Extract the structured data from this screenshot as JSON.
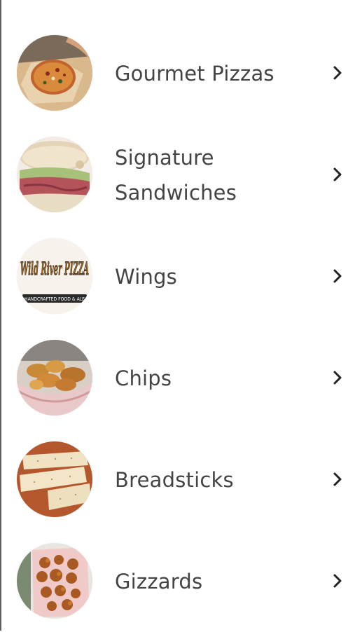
{
  "menu": {
    "items": [
      {
        "label": "Gourmet Pizzas",
        "thumbnail": "pizza-in-box-photo",
        "chevron": "chevron-right-icon"
      },
      {
        "label": "Signature Sandwiches",
        "thumbnail": "sandwich-photo",
        "chevron": "chevron-right-icon"
      },
      {
        "label": "Wings",
        "thumbnail": "wild-river-pizza-logo",
        "chevron": "chevron-right-icon"
      },
      {
        "label": "Chips",
        "thumbnail": "chips-basket-photo",
        "chevron": "chevron-right-icon"
      },
      {
        "label": "Breadsticks",
        "thumbnail": "breadsticks-photo",
        "chevron": "chevron-right-icon"
      },
      {
        "label": "Gizzards",
        "thumbnail": "gizzards-basket-photo",
        "chevron": "chevron-right-icon"
      }
    ],
    "logo_text": "Wild River PIZZA",
    "logo_tagline": "HANDCRAFTED FOOD & ALE"
  },
  "colors": {
    "background": "#ffffff",
    "text": "#444444",
    "chevron": "#222222"
  }
}
